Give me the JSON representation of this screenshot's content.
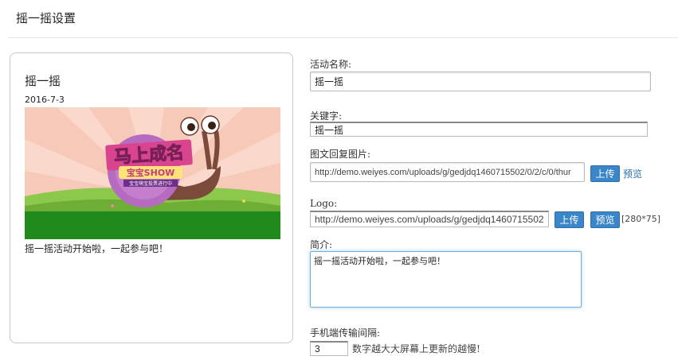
{
  "header": {
    "title": "摇一摇设置"
  },
  "preview": {
    "title": "摇一摇",
    "date": "2016-7-3",
    "banner": {
      "headline": "马上成名",
      "badge": "宝宝SHOW",
      "ribbon": "宝宝萌宝投票进行中"
    },
    "description": "摇一摇活动开始啦，一起参与吧！"
  },
  "form": {
    "activity_name": {
      "label": "活动名称:",
      "value": "摇一摇"
    },
    "keyword": {
      "label": "关键字:",
      "value": "摇一摇"
    },
    "reply_image": {
      "label": "图文回复图片:",
      "value": "http://demo.weiyes.com/uploads/g/gedjdq1460715502/0/2/c/0/thur",
      "upload_label": "上传",
      "preview_label": "预览"
    },
    "logo": {
      "label": "Logo:",
      "value": "http://demo.weiyes.com/uploads/g/gedjdq1460715502",
      "upload_label": "上传",
      "preview_label": "预览",
      "size_hint": "[280*75]"
    },
    "intro": {
      "label": "简介:",
      "value": "摇一摇活动开始啦，一起参与吧！"
    },
    "interval": {
      "label": "手机端传输间隔:",
      "value": "3",
      "hint": "数字越大大屏幕上更新的越慢!"
    }
  },
  "colors": {
    "accent_button": "#3b86c8",
    "link": "#2a6fb0",
    "focus_border": "#77aede"
  }
}
